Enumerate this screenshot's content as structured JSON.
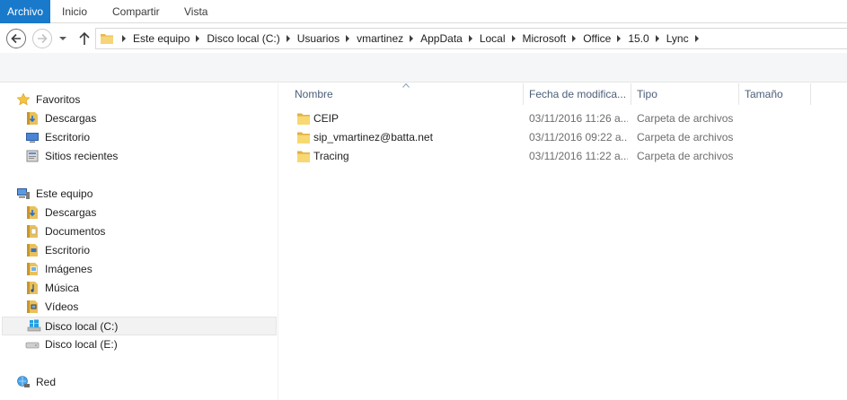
{
  "ribbon": {
    "tabs": [
      {
        "label": "Archivo"
      },
      {
        "label": "Inicio"
      },
      {
        "label": "Compartir"
      },
      {
        "label": "Vista"
      }
    ],
    "accent_color": "#1979ca"
  },
  "address": {
    "breadcrumbs": [
      "Este equipo",
      "Disco local (C:)",
      "Usuarios",
      "vmartinez",
      "AppData",
      "Local",
      "Microsoft",
      "Office",
      "15.0",
      "Lync"
    ]
  },
  "navigation": {
    "favorites": {
      "label": "Favoritos",
      "items": [
        {
          "label": "Descargas",
          "icon": "downloads-icon"
        },
        {
          "label": "Escritorio",
          "icon": "desktop-icon"
        },
        {
          "label": "Sitios recientes",
          "icon": "recent-places-icon"
        }
      ]
    },
    "this_pc": {
      "label": "Este equipo",
      "items": [
        {
          "label": "Descargas",
          "icon": "downloads-icon"
        },
        {
          "label": "Documentos",
          "icon": "documents-icon"
        },
        {
          "label": "Escritorio",
          "icon": "desktop-folder-icon"
        },
        {
          "label": "Imágenes",
          "icon": "pictures-icon"
        },
        {
          "label": "Música",
          "icon": "music-icon"
        },
        {
          "label": "Vídeos",
          "icon": "videos-icon"
        },
        {
          "label": "Disco local (C:)",
          "icon": "windows-drive-icon",
          "selected": true
        },
        {
          "label": "Disco local (E:)",
          "icon": "drive-icon"
        }
      ]
    },
    "network": {
      "label": "Red"
    }
  },
  "columns": [
    {
      "label": "Nombre"
    },
    {
      "label": "Fecha de modifica..."
    },
    {
      "label": "Tipo"
    },
    {
      "label": "Tamaño"
    }
  ],
  "files": [
    {
      "name": "CEIP",
      "date": "03/11/2016 11:26 a...",
      "type": "Carpeta de archivos"
    },
    {
      "name": "sip_vmartinez@batta.net",
      "date": "03/11/2016 09:22 a...",
      "type": "Carpeta de archivos"
    },
    {
      "name": "Tracing",
      "date": "03/11/2016 11:22 a...",
      "type": "Carpeta de archivos"
    }
  ]
}
